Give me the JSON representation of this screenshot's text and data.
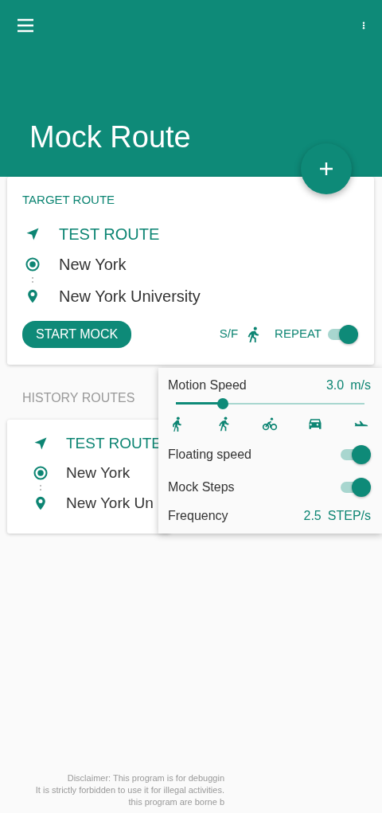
{
  "app_bar": {
    "title": "Mock Route"
  },
  "target_route": {
    "heading": "TARGET ROUTE",
    "route_name": "TEST ROUTE",
    "start": "New York",
    "end": "New York University",
    "start_button": "START MOCK",
    "mode_label": "S/F",
    "repeat_label": "REPEAT",
    "repeat_on": true
  },
  "history": {
    "heading": "HISTORY ROUTES",
    "routes": [
      {
        "route_name": "TEST ROUTE",
        "start": "New York",
        "end": "New York Un"
      }
    ]
  },
  "speed_panel": {
    "title": "Motion Speed",
    "speed_value": "3.0",
    "speed_unit": "m/s",
    "level": 0.25,
    "options": [
      {
        "label": "Floating speed",
        "on": true
      },
      {
        "label": "Mock Steps",
        "on": true
      }
    ],
    "frequency_label": "Frequency",
    "frequency_value": "2.5",
    "frequency_unit": "STEP/s"
  },
  "disclaimer": [
    "Disclaimer: This program is for debuggin",
    "It is strictly forbidden to use it for illegal activities.",
    "this program are borne b"
  ]
}
